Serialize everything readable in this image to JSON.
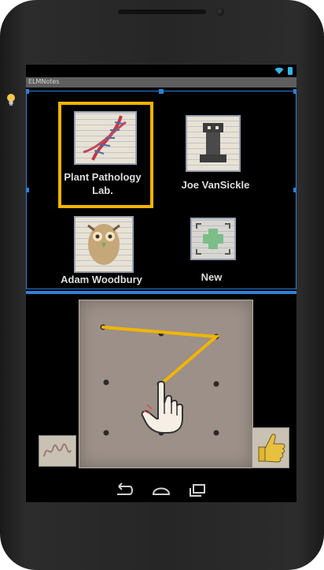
{
  "app": {
    "title": "ELMNotes"
  },
  "status_bar": {
    "wifi_icon": "wifi-icon",
    "battery_icon": "battery-icon"
  },
  "notes": [
    {
      "label_line1": "Plant Pathology",
      "label_line2": "Lab.",
      "selected": true,
      "icon": "dna-sketch"
    },
    {
      "label_line1": "Joe VanSickle",
      "label_line2": "",
      "selected": false,
      "icon": "chess-rook-sketch"
    },
    {
      "label_line1": "Adam Woodbury",
      "label_line2": "",
      "selected": false,
      "icon": "owl-sketch"
    },
    {
      "label_line1": "New",
      "label_line2": "",
      "selected": false,
      "icon": "plus-icon"
    }
  ],
  "pattern_pad": {
    "dots": 9,
    "pattern_path": [
      1,
      3,
      7
    ],
    "gesture_icon": "pointing-hand-icon"
  },
  "side_cards": {
    "left_icon": "signature-sketch",
    "right_icon": "thumbs-up-icon"
  },
  "navigation": {
    "back_icon": "back-icon",
    "home_icon": "home-icon",
    "recents_icon": "recents-icon"
  },
  "accents": {
    "selection": "#f2b400",
    "layout_guides": "#2f7fd6",
    "pattern_stroke": "#f2b400"
  }
}
